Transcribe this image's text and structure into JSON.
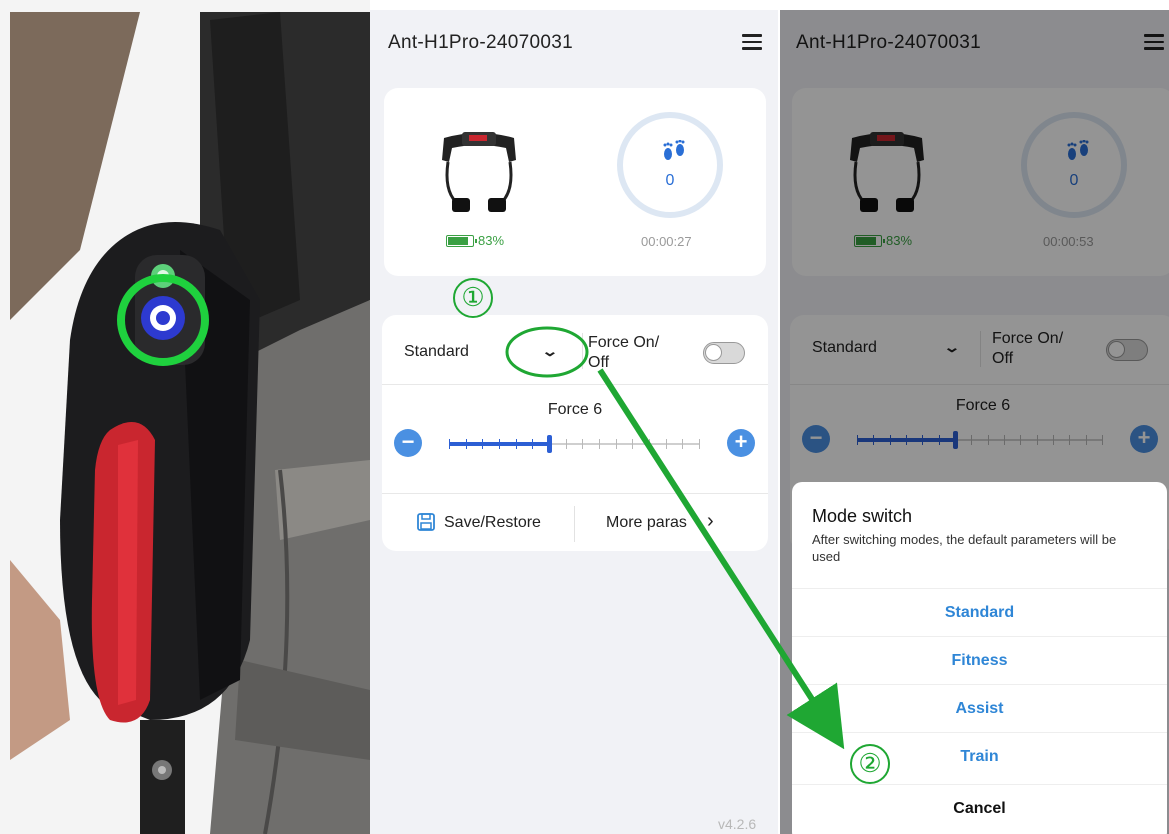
{
  "middle_screen": {
    "title": "Ant-H1Pro-24070031",
    "battery": "83%",
    "steps": "0",
    "timer": "00:00:27",
    "mode": "Standard",
    "force_toggle_line1": "Force On/",
    "force_toggle_line2": "Off",
    "force_label": "Force 6",
    "force_level": 6,
    "force_max": 15,
    "save_restore": "Save/Restore",
    "more_params": "More paras",
    "version": "v4.2.6"
  },
  "right_screen": {
    "title": "Ant-H1Pro-24070031",
    "battery": "83%",
    "steps": "0",
    "timer": "00:00:53",
    "mode": "Standard",
    "force_toggle_line1": "Force On/",
    "force_toggle_line2": "Off",
    "force_label": "Force 6",
    "sheet": {
      "title": "Mode switch",
      "description": "After switching modes, the default parameters will be used",
      "options": [
        "Standard",
        "Fitness",
        "Assist",
        "Train"
      ],
      "cancel": "Cancel"
    }
  },
  "annotations": {
    "step1": "①",
    "step2": "②"
  },
  "colors": {
    "accent_blue": "#2f86d6",
    "battery_green": "#3aa043",
    "annotation_green": "#1fa733",
    "slider_blue": "#2c5fd4"
  }
}
